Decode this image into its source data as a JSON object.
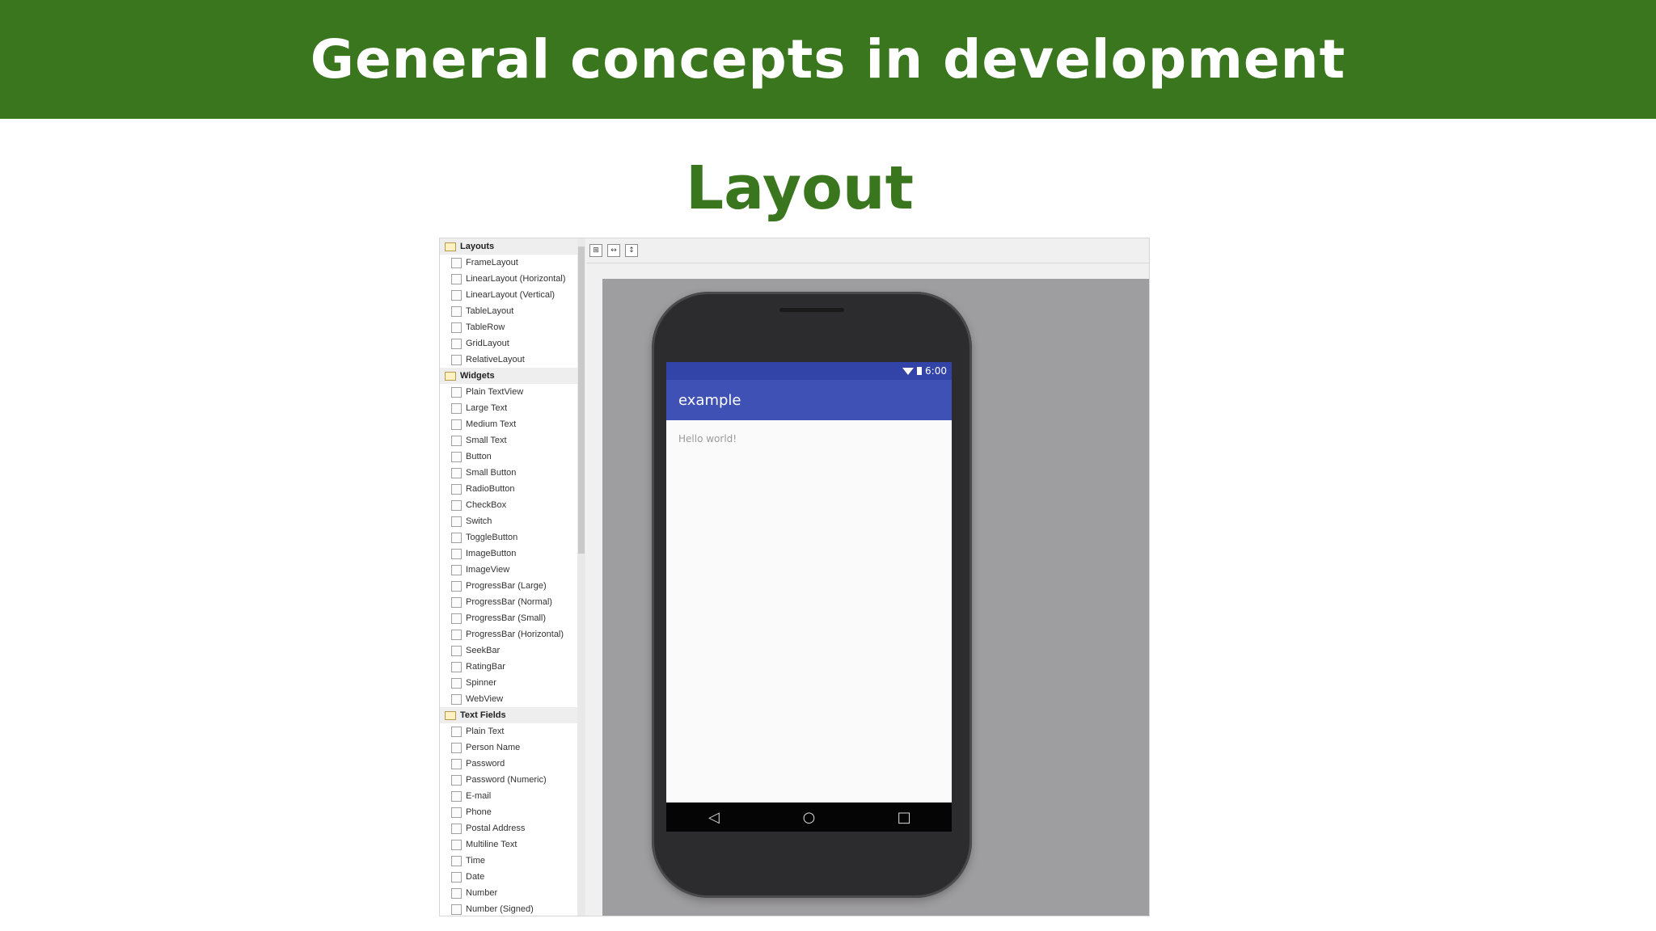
{
  "header": {
    "title": "General concepts in development"
  },
  "slide": {
    "subtitle": "Layout"
  },
  "palette": {
    "items": [
      {
        "type": "category",
        "label": "Layouts",
        "icon": "folder-icon"
      },
      {
        "type": "entry",
        "label": "FrameLayout",
        "icon": "frame-layout-icon"
      },
      {
        "type": "entry",
        "label": "LinearLayout (Horizontal)",
        "icon": "linear-layout-horizontal-icon"
      },
      {
        "type": "entry",
        "label": "LinearLayout (Vertical)",
        "icon": "linear-layout-vertical-icon"
      },
      {
        "type": "entry",
        "label": "TableLayout",
        "icon": "table-layout-icon"
      },
      {
        "type": "entry",
        "label": "TableRow",
        "icon": "table-row-icon"
      },
      {
        "type": "entry",
        "label": "GridLayout",
        "icon": "grid-layout-icon"
      },
      {
        "type": "entry",
        "label": "RelativeLayout",
        "icon": "relative-layout-icon"
      },
      {
        "type": "category",
        "label": "Widgets",
        "icon": "folder-icon"
      },
      {
        "type": "entry",
        "label": "Plain TextView",
        "icon": "textview-icon"
      },
      {
        "type": "entry",
        "label": "Large Text",
        "icon": "textview-icon"
      },
      {
        "type": "entry",
        "label": "Medium Text",
        "icon": "textview-icon"
      },
      {
        "type": "entry",
        "label": "Small Text",
        "icon": "textview-icon"
      },
      {
        "type": "entry",
        "label": "Button",
        "icon": "button-icon"
      },
      {
        "type": "entry",
        "label": "Small Button",
        "icon": "button-icon"
      },
      {
        "type": "entry",
        "label": "RadioButton",
        "icon": "radio-button-icon"
      },
      {
        "type": "entry",
        "label": "CheckBox",
        "icon": "checkbox-icon"
      },
      {
        "type": "entry",
        "label": "Switch",
        "icon": "switch-icon"
      },
      {
        "type": "entry",
        "label": "ToggleButton",
        "icon": "toggle-button-icon"
      },
      {
        "type": "entry",
        "label": "ImageButton",
        "icon": "image-button-icon"
      },
      {
        "type": "entry",
        "label": "ImageView",
        "icon": "image-view-icon"
      },
      {
        "type": "entry",
        "label": "ProgressBar (Large)",
        "icon": "progress-bar-icon"
      },
      {
        "type": "entry",
        "label": "ProgressBar (Normal)",
        "icon": "progress-bar-icon"
      },
      {
        "type": "entry",
        "label": "ProgressBar (Small)",
        "icon": "progress-bar-icon"
      },
      {
        "type": "entry",
        "label": "ProgressBar (Horizontal)",
        "icon": "progress-bar-icon"
      },
      {
        "type": "entry",
        "label": "SeekBar",
        "icon": "seekbar-icon"
      },
      {
        "type": "entry",
        "label": "RatingBar",
        "icon": "rating-bar-icon"
      },
      {
        "type": "entry",
        "label": "Spinner",
        "icon": "spinner-icon"
      },
      {
        "type": "entry",
        "label": "WebView",
        "icon": "webview-icon"
      },
      {
        "type": "category",
        "label": "Text Fields",
        "icon": "folder-icon"
      },
      {
        "type": "entry",
        "label": "Plain Text",
        "icon": "text-field-icon"
      },
      {
        "type": "entry",
        "label": "Person Name",
        "icon": "text-field-icon"
      },
      {
        "type": "entry",
        "label": "Password",
        "icon": "text-field-icon"
      },
      {
        "type": "entry",
        "label": "Password (Numeric)",
        "icon": "text-field-icon"
      },
      {
        "type": "entry",
        "label": "E-mail",
        "icon": "text-field-icon"
      },
      {
        "type": "entry",
        "label": "Phone",
        "icon": "text-field-icon"
      },
      {
        "type": "entry",
        "label": "Postal Address",
        "icon": "text-field-icon"
      },
      {
        "type": "entry",
        "label": "Multiline Text",
        "icon": "text-field-icon"
      },
      {
        "type": "entry",
        "label": "Time",
        "icon": "text-field-icon"
      },
      {
        "type": "entry",
        "label": "Date",
        "icon": "text-field-icon"
      },
      {
        "type": "entry",
        "label": "Number",
        "icon": "text-field-icon"
      },
      {
        "type": "entry",
        "label": "Number (Signed)",
        "icon": "text-field-icon"
      }
    ]
  },
  "toolbar": {
    "buttons": [
      {
        "icon": "zoom-fit-icon"
      },
      {
        "icon": "fit-width-icon"
      },
      {
        "icon": "fit-height-icon"
      }
    ]
  },
  "device": {
    "status_time": "6:00",
    "app_title": "example",
    "content_text": "Hello world!",
    "nav": {
      "back": "◁",
      "home": "○",
      "recents": "□"
    }
  },
  "colors": {
    "header_bg": "#3a761e",
    "subtitle": "#3a761e",
    "app_bar": "#3f51b5",
    "status_bar": "#3344a8",
    "canvas_bg": "#9e9d9f"
  }
}
